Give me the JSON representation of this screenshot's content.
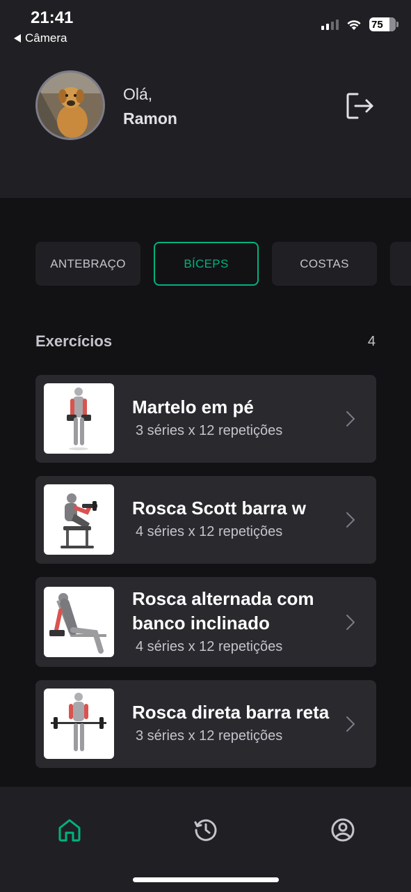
{
  "status_bar": {
    "time": "21:41",
    "back_label": "Câmera",
    "battery": "75"
  },
  "header": {
    "greeting": "Olá,",
    "user_name": "Ramon",
    "avatar_icon": "dog-photo-avatar",
    "logout_icon": "logout-icon"
  },
  "groups": [
    {
      "label": "ANTEBRAÇO",
      "active": false
    },
    {
      "label": "BÍCEPS",
      "active": true
    },
    {
      "label": "COSTAS",
      "active": false
    }
  ],
  "exercises_section": {
    "title": "Exercícios",
    "count": "4"
  },
  "exercises": [
    {
      "name": "Martelo em pé",
      "meta": "3 séries x 12 repetições",
      "thumb_icon": "standing-dumbbell-curl-illustration"
    },
    {
      "name": "Rosca Scott barra w",
      "meta": "4 séries x 12 repetições",
      "thumb_icon": "preacher-curl-illustration"
    },
    {
      "name": "Rosca alternada com banco inclinado",
      "name_line1": "Rosca alternada com",
      "name_line2": "banco inclinado",
      "meta": "4 séries x 12 repetições",
      "thumb_icon": "incline-dumbbell-curl-illustration"
    },
    {
      "name": "Rosca direta barra reta",
      "meta": "3 séries x 12 repetições",
      "thumb_icon": "barbell-curl-illustration"
    }
  ],
  "tab_bar": {
    "items": [
      "home-icon",
      "history-icon",
      "profile-icon"
    ],
    "active": "home-icon"
  },
  "colors": {
    "accent": "#00b37e",
    "background": "#121214",
    "surface": "#202024",
    "card": "#29292e"
  }
}
